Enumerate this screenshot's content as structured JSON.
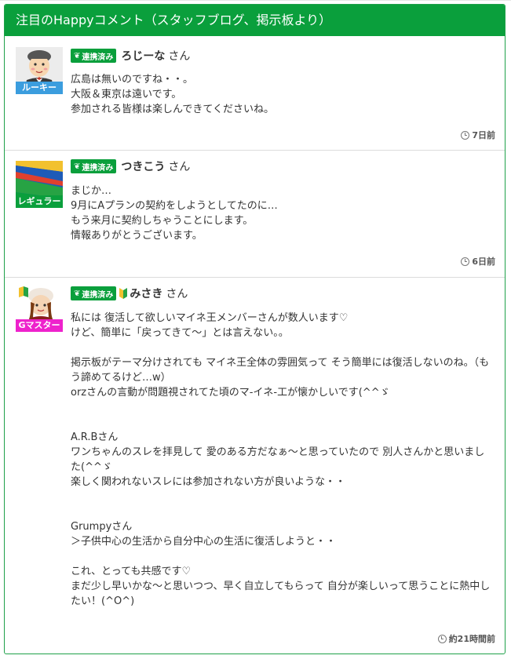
{
  "panel": {
    "title": "注目のHappyコメント（スタッフブログ、掲示板より）"
  },
  "badge_label": "連携済み",
  "san": "さん",
  "comments": [
    {
      "rank": "ルーキー",
      "rank_color": "#3b9dde",
      "name": "ろじーな",
      "text": "広島は無いのですね・・。\n大阪＆東京は遠いです。\n参加される皆様は楽しんできてくださいね。",
      "time": "7日前"
    },
    {
      "rank": "レギュラー",
      "rank_color": "#0a9f3c",
      "name": "つきこう",
      "text": "まじか…\n9月にAプランの契約をしようとしてたのに…\nもう来月に契約しちゃうことにします。\n情報ありがとうございます。",
      "time": "6日前"
    },
    {
      "rank": "Gマスター",
      "rank_color": "#ee22cc",
      "name": "みさき",
      "text": "私には 復活して欲しいマイネ王メンバーさんが数人います♡\nけど、簡単に「戻ってきて～」とは言えない。。\n\n掲示板がテーマ分けされても マイネ王全体の雰囲気って そう簡単には復活しないのね。（もう諦めてるけど…w）\norzさんの言動が問題視されてた頃のマ-イネ-工が懐かしいです(^^ゞ\n\n\nA.R.Bさん\nワンちゃんのスレを拝見して 愛のある方だなぁ～と思っていたので 別人さんかと思いました(^^ゞ\n楽しく関われないスレには参加されない方が良いような・・\n\n\nGrumpyさん\n＞子供中心の生活から自分中心の生活に復活しようと・・\n\nこれ、とっても共感です♡\nまだ少し早いかな～と思いつつ、早く自立してもらって 自分が楽しいって思うことに熱中したい！(^O^)",
      "time": "約21時間前"
    }
  ]
}
